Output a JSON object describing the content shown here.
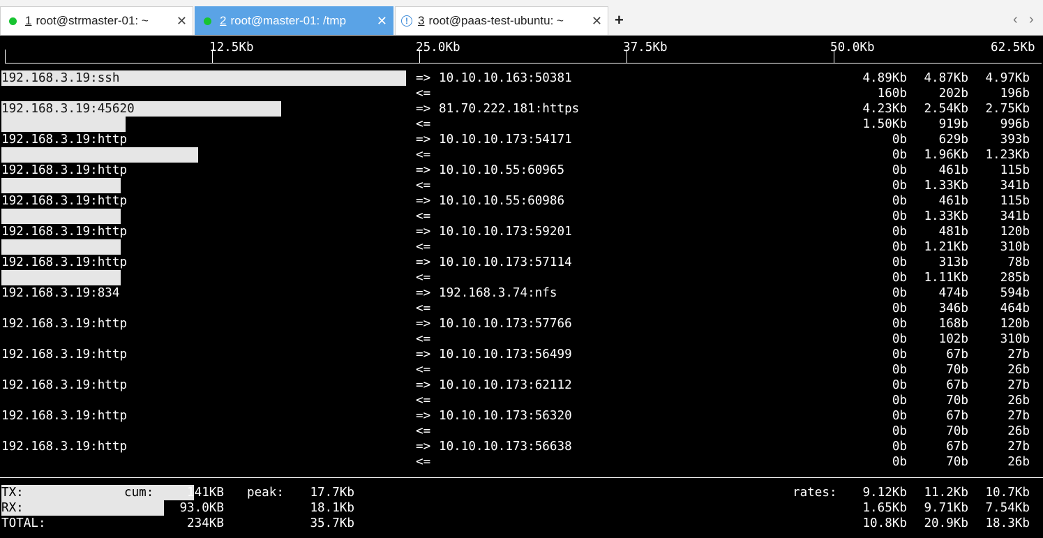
{
  "tabs": [
    {
      "num": "1",
      "label": "root@strmaster-01: ~",
      "status": "connected",
      "icon": "green-dot-icon"
    },
    {
      "num": "2",
      "label": "root@master-01: /tmp",
      "status": "connected",
      "icon": "green-dot-icon"
    },
    {
      "num": "3",
      "label": "root@paas-test-ubuntu: ~",
      "status": "warning",
      "icon": "info-icon"
    }
  ],
  "tabbar": {
    "close_symbol": "✕",
    "new_tab_symbol": "+",
    "nav_prev": "‹",
    "nav_next": "›",
    "info_glyph": "!"
  },
  "scale": {
    "labels": [
      "12.5Kb",
      "25.0Kb",
      "37.5Kb",
      "50.0Kb",
      "62.5Kb"
    ]
  },
  "connections": [
    {
      "src": "192.168.3.19:ssh",
      "dst": "10.10.10.163:50381",
      "tx": [
        "4.89Kb",
        "4.87Kb",
        "4.97Kb"
      ],
      "rx": [
        "160b",
        "202b",
        "196b"
      ],
      "tx_fraction": 0.39,
      "rx_fraction": 0.0
    },
    {
      "src": "192.168.3.19:45620",
      "dst": "81.70.222.181:https",
      "tx": [
        "4.23Kb",
        "2.54Kb",
        "2.75Kb"
      ],
      "rx": [
        "1.50Kb",
        "919b",
        "996b"
      ],
      "tx_fraction": 0.27,
      "rx_fraction": 0.12
    },
    {
      "src": "192.168.3.19:http",
      "dst": "10.10.10.173:54171",
      "tx": [
        "0b",
        "629b",
        "393b"
      ],
      "rx": [
        "0b",
        "1.96Kb",
        "1.23Kb"
      ],
      "tx_fraction": 0.0,
      "rx_fraction": 0.19
    },
    {
      "src": "192.168.3.19:http",
      "dst": "10.10.10.55:60965",
      "tx": [
        "0b",
        "461b",
        "115b"
      ],
      "rx": [
        "0b",
        "1.33Kb",
        "341b"
      ],
      "tx_fraction": 0.0,
      "rx_fraction": 0.115
    },
    {
      "src": "192.168.3.19:http",
      "dst": "10.10.10.55:60986",
      "tx": [
        "0b",
        "461b",
        "115b"
      ],
      "rx": [
        "0b",
        "1.33Kb",
        "341b"
      ],
      "tx_fraction": 0.0,
      "rx_fraction": 0.115
    },
    {
      "src": "192.168.3.19:http",
      "dst": "10.10.10.173:59201",
      "tx": [
        "0b",
        "481b",
        "120b"
      ],
      "rx": [
        "0b",
        "1.21Kb",
        "310b"
      ],
      "tx_fraction": 0.0,
      "rx_fraction": 0.115
    },
    {
      "src": "192.168.3.19:http",
      "dst": "10.10.10.173:57114",
      "tx": [
        "0b",
        "313b",
        "78b"
      ],
      "rx": [
        "0b",
        "1.11Kb",
        "285b"
      ],
      "tx_fraction": 0.0,
      "rx_fraction": 0.115
    },
    {
      "src": "192.168.3.19:834",
      "dst": "192.168.3.74:nfs",
      "tx": [
        "0b",
        "474b",
        "594b"
      ],
      "rx": [
        "0b",
        "346b",
        "464b"
      ],
      "tx_fraction": 0.0,
      "rx_fraction": 0.0
    },
    {
      "src": "192.168.3.19:http",
      "dst": "10.10.10.173:57766",
      "tx": [
        "0b",
        "168b",
        "120b"
      ],
      "rx": [
        "0b",
        "102b",
        "310b"
      ],
      "tx_fraction": 0.0,
      "rx_fraction": 0.0
    },
    {
      "src": "192.168.3.19:http",
      "dst": "10.10.10.173:56499",
      "tx": [
        "0b",
        "67b",
        "27b"
      ],
      "rx": [
        "0b",
        "70b",
        "26b"
      ],
      "tx_fraction": 0.0,
      "rx_fraction": 0.0
    },
    {
      "src": "192.168.3.19:http",
      "dst": "10.10.10.173:62112",
      "tx": [
        "0b",
        "67b",
        "27b"
      ],
      "rx": [
        "0b",
        "70b",
        "26b"
      ],
      "tx_fraction": 0.0,
      "rx_fraction": 0.0
    },
    {
      "src": "192.168.3.19:http",
      "dst": "10.10.10.173:56320",
      "tx": [
        "0b",
        "67b",
        "27b"
      ],
      "rx": [
        "0b",
        "70b",
        "26b"
      ],
      "tx_fraction": 0.0,
      "rx_fraction": 0.0
    },
    {
      "src": "192.168.3.19:http",
      "dst": "10.10.10.173:56638",
      "tx": [
        "0b",
        "67b",
        "27b"
      ],
      "rx": [
        "0b",
        "70b",
        "26b"
      ],
      "tx_fraction": 0.0,
      "rx_fraction": 0.0
    }
  ],
  "arrows": {
    "out": "=>",
    "in": "<="
  },
  "totals": {
    "tx": {
      "label": "TX:",
      "cum_label": "cum:",
      "cum": "141KB",
      "peak_label": "peak:",
      "peak": "17.7Kb",
      "rates_label": "rates:",
      "rates": [
        "9.12Kb",
        "11.2Kb",
        "10.7Kb"
      ],
      "bar_fraction": 0.186
    },
    "rx": {
      "label": "RX:",
      "cum": "93.0KB",
      "peak": "18.1Kb",
      "rates": [
        "1.65Kb",
        "9.71Kb",
        "7.54Kb"
      ],
      "bar_fraction": 0.157
    },
    "total": {
      "label": "TOTAL:",
      "cum": "234KB",
      "peak": "35.7Kb",
      "rates": [
        "10.8Kb",
        "20.9Kb",
        "18.3Kb"
      ]
    }
  }
}
